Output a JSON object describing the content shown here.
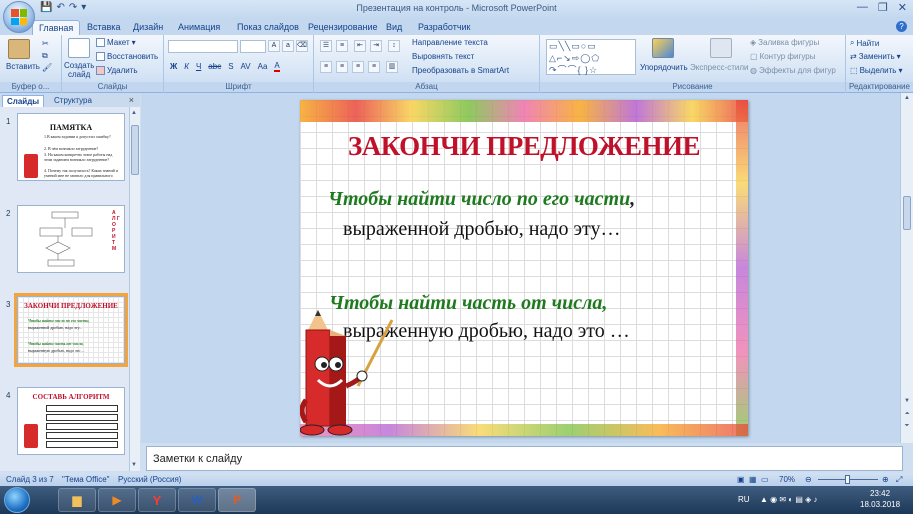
{
  "window": {
    "title": "Презентация на контроль - Microsoft PowerPoint"
  },
  "ribbon_tabs": [
    "Главная",
    "Вставка",
    "Дизайн",
    "Анимация",
    "Показ слайдов",
    "Рецензирование",
    "Вид",
    "Разработчик"
  ],
  "ribbon": {
    "clipboard": {
      "paste": "Вставить",
      "label": "Буфер о..."
    },
    "slides": {
      "create": "Создать",
      "create2": "слайд",
      "layout": "Макет",
      "reset": "Восстановить",
      "delete": "Удалить",
      "label": "Слайды"
    },
    "font": {
      "label": "Шрифт",
      "buttons": [
        "Ж",
        "К",
        "Ч",
        "abc",
        "S",
        "AV",
        "Aa",
        "A"
      ]
    },
    "paragraph": {
      "text_direction": "Направление текста",
      "align_text": "Выровнять текст",
      "smartart": "Преобразовать в SmartArt",
      "label": "Абзац"
    },
    "drawing": {
      "arrange": "Упорядочить",
      "quick_styles": "Экспресс-стили",
      "fill": "Заливка фигуры",
      "outline": "Контур фигуры",
      "effects": "Эффекты для фигур",
      "label": "Рисование"
    },
    "editing": {
      "find": "Найти",
      "replace": "Заменить",
      "select": "Выделить",
      "label": "Редактирование"
    }
  },
  "left_panel": {
    "tabs": [
      "Слайды",
      "Структура"
    ],
    "close": "×",
    "slides": [
      {
        "num": "1",
        "title": "ПАМЯТКА",
        "lines": [
          "1.В каком задании я допустил ошибку?",
          "2. В чём возникло затруднение?",
          "3. На каком конкретно этапе работы над этим заданием возникло затруднение?",
          "4. Почему так получилось? Каких знаний и умений мне не хватило для правильного решения?"
        ]
      },
      {
        "num": "2",
        "side_text": "А Л Г О Р И Т М"
      },
      {
        "num": "3",
        "title": "ЗАКОНЧИ ПРЕДЛОЖЕНИЕ",
        "lines": [
          "Чтобы найти число по его части,",
          "выраженной дробью, надо эту...",
          "Чтобы найти часть от числа,",
          "выраженную дробью, надо это ..."
        ]
      },
      {
        "num": "4",
        "title": "СОСТАВЬ АЛГОРИТМ"
      }
    ]
  },
  "slide": {
    "title": "ЗАКОНЧИ ПРЕДЛОЖЕНИЕ",
    "line1_green": "Чтобы найти число по его части",
    "line1_comma": ",",
    "line2": "выраженной дробью, надо эту…",
    "line3_green": "Чтобы найти часть от числа,",
    "line4": "выраженную дробью, надо это …"
  },
  "notes": {
    "placeholder": "Заметки к слайду"
  },
  "status": {
    "slide": "Слайд 3 из 7",
    "theme": "\"Тема Office\"",
    "language": "Русский (Россия)",
    "zoom": "70%",
    "zoom_level": 0.7
  },
  "taskbar": {
    "lang": "RU",
    "time": "23:42",
    "date": "18.03.2018"
  },
  "colors": {
    "title_red": "#c0102a",
    "phrase_green": "#1f7a1f",
    "ribbon_blue": "#15428b",
    "selected_thumb": "#f4a43e"
  }
}
